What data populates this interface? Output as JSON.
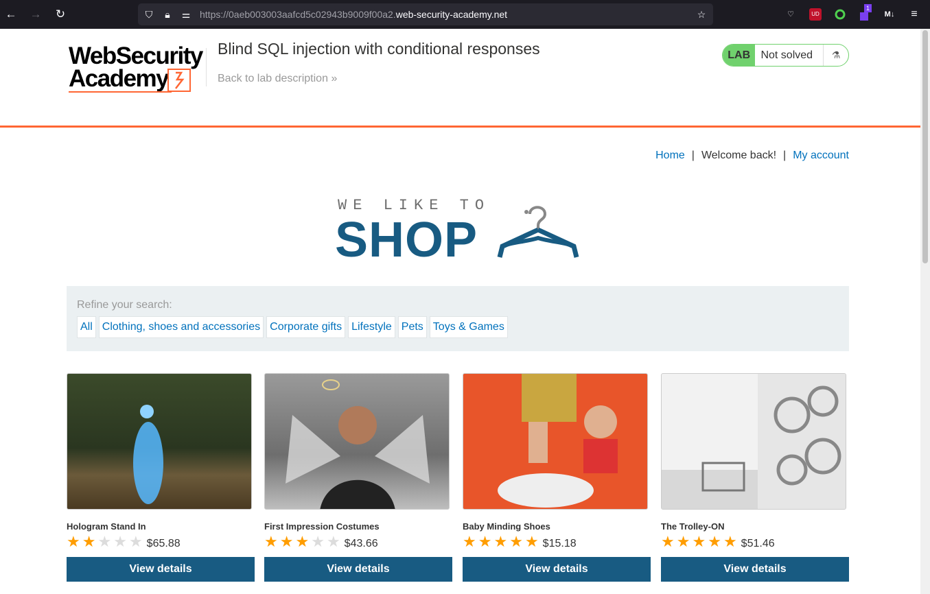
{
  "browser": {
    "url_prefix": "https://0aeb003003aafcd5c02943b9009f00a2.",
    "url_domain": "web-security-academy.net",
    "ext_badge": "1",
    "ext_ub": "UD",
    "ext_md": "M↓"
  },
  "lab": {
    "logo_line1": "WebSecurity",
    "logo_line2": "Academy",
    "title": "Blind SQL injection with conditional responses",
    "back_link": "Back to lab description",
    "tag": "LAB",
    "status": "Not solved"
  },
  "nav": {
    "home": "Home",
    "separator": "|",
    "welcome": "Welcome back!",
    "account": "My account"
  },
  "shop_logo": {
    "small": "WE LIKE TO",
    "big": "SHOP"
  },
  "filter": {
    "label": "Refine your search:",
    "items": [
      "All",
      "Clothing, shoes and accessories",
      "Corporate gifts",
      "Lifestyle",
      "Pets",
      "Toys & Games"
    ]
  },
  "products": [
    {
      "name": "Hologram Stand In",
      "price": "$65.88",
      "rating": 2,
      "button": "View details"
    },
    {
      "name": "First Impression Costumes",
      "price": "$43.66",
      "rating": 3,
      "button": "View details"
    },
    {
      "name": "Baby Minding Shoes",
      "price": "$15.18",
      "rating": 5,
      "button": "View details"
    },
    {
      "name": "The Trolley-ON",
      "price": "$51.46",
      "rating": 5,
      "button": "View details"
    }
  ],
  "colors": {
    "accent": "#ff6633",
    "brand": "#185b82",
    "link": "#0071bc",
    "lab_green": "#70d16d",
    "star": "#ff9d00"
  }
}
